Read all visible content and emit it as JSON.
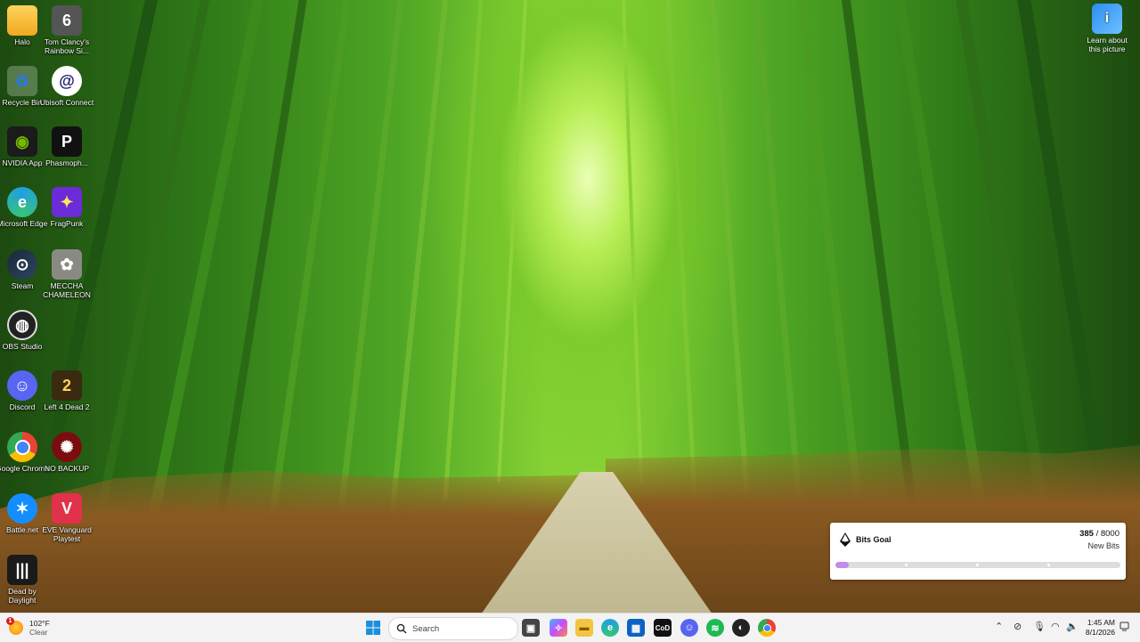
{
  "desktop": {
    "col1": [
      {
        "label": "Halo",
        "icon": "folder-icon"
      },
      {
        "label": "Recycle Bin",
        "icon": "recycle-bin-icon"
      },
      {
        "label": "NVIDIA App",
        "icon": "nvidia-icon"
      },
      {
        "label": "Microsoft Edge",
        "icon": "edge-icon"
      },
      {
        "label": "Steam",
        "icon": "steam-icon"
      },
      {
        "label": "OBS Studio",
        "icon": "obs-icon"
      },
      {
        "label": "Discord",
        "icon": "discord-icon"
      },
      {
        "label": "Google Chrome",
        "icon": "chrome-icon"
      },
      {
        "label": "Battle.net",
        "icon": "battlenet-icon"
      },
      {
        "label": "Dead by Daylight",
        "icon": "dead-by-daylight-icon"
      }
    ],
    "col2": [
      {
        "label": "Tom Clancy's Rainbow Si...",
        "icon": "rainbow-six-icon"
      },
      {
        "label": "Ubisoft Connect",
        "icon": "ubisoft-icon"
      },
      {
        "label": "Phasmoph...",
        "icon": "phasmophobia-icon"
      },
      {
        "label": "FragPunk",
        "icon": "fragpunk-icon"
      },
      {
        "label": "MECCHA CHAMELEON",
        "icon": "meccha-chameleon-icon"
      },
      {
        "label": "Left 4 Dead 2",
        "icon": "left4dead2-icon"
      },
      {
        "label": "NO BACKUP",
        "icon": "no-backup-icon"
      },
      {
        "label": "EVE Vanguard Playtest",
        "icon": "eve-vanguard-icon"
      }
    ],
    "learn": {
      "label": "Learn about this picture",
      "icon": "learn-about-picture-icon"
    }
  },
  "bits_goal": {
    "title": "Bits Goal",
    "current": "385",
    "separator": " / ",
    "goal": "8000",
    "unit_label": "New Bits",
    "progress_fraction": 0.048
  },
  "taskbar": {
    "weather": {
      "temp": "102°F",
      "condition": "Clear",
      "badge": "1"
    },
    "search_placeholder": "Search",
    "clock": {
      "time": "1:45 AM",
      "date": "8/1/2026"
    }
  }
}
